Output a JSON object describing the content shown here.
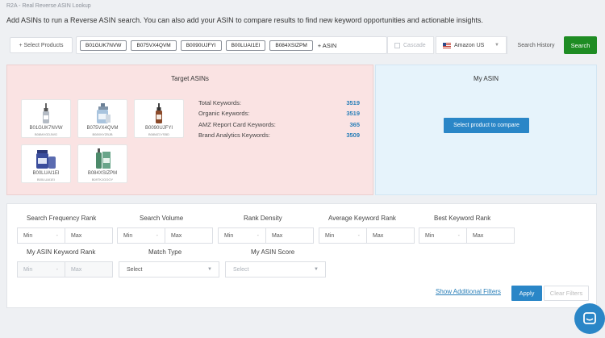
{
  "breadcrumb": "R2A - Real Reverse ASIN Lookup",
  "intro": "Add ASINs to run a Reverse ASIN search. You can also add your ASIN to compare results to find new keyword opportunities and actionable insights.",
  "toolbar": {
    "select_products": "+ Select Products",
    "asins": [
      "B01GUK7NVW",
      "B075VX4QVM",
      "B0090UJFYI",
      "B00LUAI1EI",
      "B084XSIZPM"
    ],
    "add_asin": "+ ASIN",
    "cascade": "Cascade",
    "marketplace": "Amazon US",
    "search_history": "Search History",
    "search": "Search"
  },
  "target": {
    "title": "Target ASINs",
    "products": [
      {
        "asin": "B01GUK7NVW",
        "sub": "B08MVGDJWG",
        "icon": "dropper-bottle-icon"
      },
      {
        "asin": "B075VX4QVM",
        "sub": "B08XNYZBJB",
        "icon": "spray-bottle-icon"
      },
      {
        "asin": "B0090UJFYI",
        "sub": "B08MZ1YSBD",
        "icon": "amber-bottle-icon"
      },
      {
        "asin": "B00LUAI1EI",
        "sub": "B00LUAI1EI",
        "icon": "jar-icon"
      },
      {
        "asin": "B084XSIZPM",
        "sub": "B09TKJGGGY",
        "icon": "box-bottle-icon"
      }
    ],
    "stats": [
      {
        "label": "Total Keywords:",
        "value": "3519"
      },
      {
        "label": "Organic Keywords:",
        "value": "3519"
      },
      {
        "label": "AMZ Report Card Keywords:",
        "value": "365"
      },
      {
        "label": "Brand Analytics Keywords:",
        "value": "3509"
      }
    ]
  },
  "my_asin": {
    "title": "My ASIN",
    "button": "Select product to compare"
  },
  "filters": {
    "search_frequency_rank": {
      "label": "Search Frequency Rank",
      "min": "Min",
      "max": "Max"
    },
    "search_volume": {
      "label": "Search Volume",
      "min": "Min",
      "max": "Max"
    },
    "rank_density": {
      "label": "Rank Density",
      "min": "Min",
      "max": "Max"
    },
    "avg_keyword_rank": {
      "label": "Average Keyword Rank",
      "min": "Min",
      "max": "Max"
    },
    "best_keyword_rank": {
      "label": "Best Keyword Rank",
      "min": "Min",
      "max": "Max"
    },
    "my_asin_keyword_rank": {
      "label": "My ASIN Keyword Rank",
      "min": "Min",
      "max": "Max"
    },
    "match_type": {
      "label": "Match Type",
      "value": "Select"
    },
    "my_asin_score": {
      "label": "My ASIN Score",
      "value": "Select"
    },
    "show_additional": "Show Additional Filters",
    "apply": "Apply",
    "clear": "Clear Filters"
  },
  "colors": {
    "search_button": "#1e8c23",
    "primary_button": "#2a86c7",
    "target_panel": "#fae3e3",
    "my_asin_panel": "#e6f3fb",
    "stat_value": "#2a7fb8"
  }
}
